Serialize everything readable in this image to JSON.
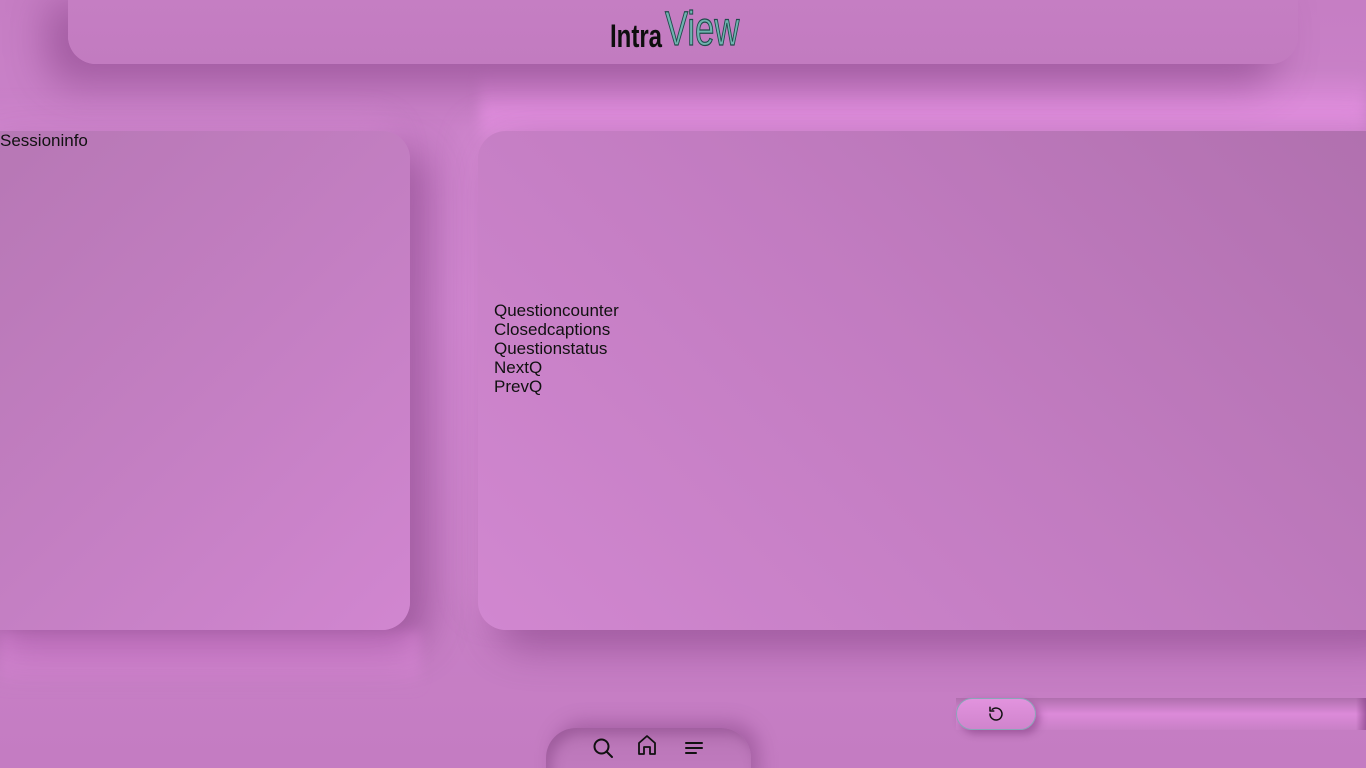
{
  "header": {
    "logo": {
      "part1": "Intra",
      "part2": "View"
    }
  },
  "session_panel": {
    "label": "Sessioninfo"
  },
  "question_panel": {
    "items": [
      "Questioncounter",
      "Closedcaptions",
      "Questionstatus",
      "NextQ",
      "PrevQ"
    ]
  },
  "controls": {
    "reset_icon": "rotate-ccw-icon"
  },
  "nav": {
    "icons": [
      "search-icon",
      "home-icon",
      "menu-icon"
    ]
  },
  "colors": {
    "background": "#c67ec4",
    "logo_accent": "#6fb3b0",
    "logo_dark": "#0e0e0e"
  }
}
